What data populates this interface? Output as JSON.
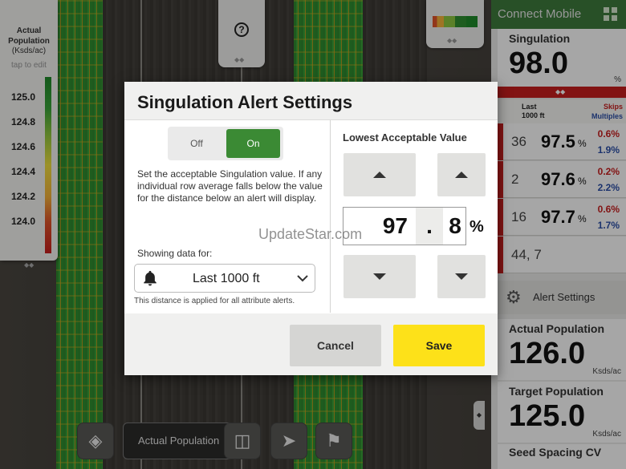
{
  "legend": {
    "title": "Actual Population",
    "unit": "(Ksds/ac)",
    "hint": "tap to edit",
    "values": [
      "125.0",
      "124.8",
      "124.6",
      "124.4",
      "124.2",
      "124.0"
    ]
  },
  "panel": {
    "header_title": "Connect Mobile",
    "singulation": {
      "label": "Singulation",
      "value": "98.0",
      "unit": "%"
    },
    "table_head": {
      "col1": "Last 1000 ft",
      "skips": "Skips",
      "multiples": "Multiples"
    },
    "rows": [
      {
        "row": "36",
        "value": "97.5",
        "unit": "%",
        "skips": "0.6%",
        "multiples": "1.9%"
      },
      {
        "row": "2",
        "value": "97.6",
        "unit": "%",
        "skips": "0.2%",
        "multiples": "2.2%"
      },
      {
        "row": "16",
        "value": "97.7",
        "unit": "%",
        "skips": "0.6%",
        "multiples": "1.7%"
      },
      {
        "row": "44, 7"
      }
    ],
    "alert_settings_label": "Alert Settings",
    "actual_population": {
      "label": "Actual Population",
      "value": "126.0",
      "unit": "Ksds/ac"
    },
    "target_population": {
      "label": "Target Population",
      "value": "125.0",
      "unit": "Ksds/ac"
    },
    "seed_spacing_label": "Seed Spacing CV"
  },
  "toolbar": {
    "layer_label": "Actual Population"
  },
  "modal": {
    "title": "Singulation Alert Settings",
    "toggle": {
      "off": "Off",
      "on": "On",
      "selected": "On"
    },
    "description": "Set the acceptable Singulation value. If any individual row average falls below the value for the distance below an alert will display.",
    "showing_label": "Showing data for:",
    "distance_value": "Last 1000 ft",
    "distance_note": "This distance is applied for all attribute alerts.",
    "lowest_title": "Lowest Acceptable Value",
    "value_int": "97",
    "value_dot": ".",
    "value_dec": "8",
    "value_unit": "%",
    "cancel": "Cancel",
    "save": "Save"
  },
  "watermark": "UpdateStar.com",
  "colors": {
    "brand_green": "#3e7b3c",
    "toggle_on": "#3b8a34",
    "save_yellow": "#fde119",
    "alert_red": "#c81e1e",
    "multiples_blue": "#2b4fa8"
  }
}
